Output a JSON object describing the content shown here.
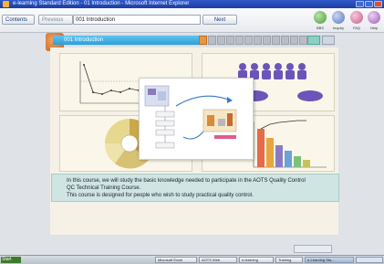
{
  "window": {
    "title": "e-learning Standard Edition - 01 Introduction - Microsoft Internet Explorer"
  },
  "toolbar": {
    "contents_label": "Contents",
    "previous_label": "Previous",
    "chapter_title": "001 Introduction",
    "next_label": "Next",
    "tools": [
      {
        "label": "BBS",
        "color": "#7bc36a"
      },
      {
        "label": "Inquiry",
        "color": "#8aa2d9"
      },
      {
        "label": "FAQ",
        "color": "#e08ab4"
      },
      {
        "label": "Help",
        "color": "#c88fd6"
      }
    ]
  },
  "lesson": {
    "title": "001 Introduction",
    "step_count": 12,
    "active_step": 1
  },
  "description": {
    "line1": "In this course, we will study the basic knowledge needed to participate in the AOTS Quality Control",
    "line2": "QC Technical Training Course.",
    "line3": "This course is designed for people who wish to study practical quality control."
  },
  "taskbar": {
    "start_label": "Start",
    "items": [
      "Microsoft Excel",
      "AOTS Web",
      "e-learning",
      "Training",
      "e-Learning Sta..."
    ]
  }
}
